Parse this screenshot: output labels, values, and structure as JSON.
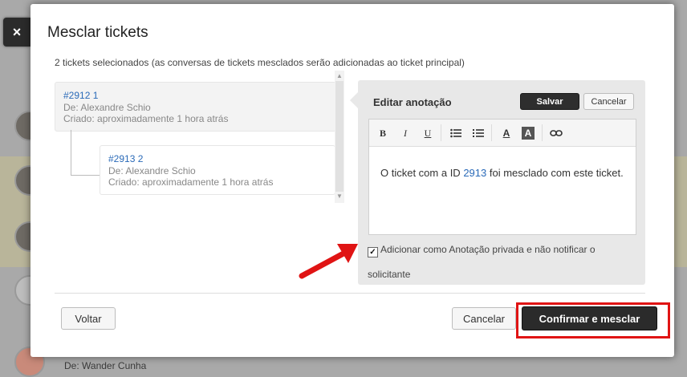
{
  "dialog": {
    "close_glyph": "×",
    "title": "Mesclar tickets",
    "subtitle": "2 tickets selecionados (as conversas de tickets mesclados serão adicionadas ao ticket principal)"
  },
  "tickets": [
    {
      "id_label": "#2912 1",
      "author": "De: Alexandre Schio",
      "created": "Criado: aproximadamente 1 hora atrás"
    },
    {
      "id_label": "#2913 2",
      "author": "De: Alexandre Schio",
      "created": "Criado: aproximadamente 1 hora atrás"
    }
  ],
  "note_panel": {
    "title": "Editar anotação",
    "save_label": "Salvar",
    "cancel_label": "Cancelar",
    "toolbar": {
      "bold": "B",
      "italic": "I",
      "underline": "U",
      "text_color": "A",
      "bg_color": "A"
    },
    "note_text_before": "O ticket com a ID ",
    "note_link": "2913",
    "note_text_after": " foi mesclado com este ticket.",
    "private_checkbox_label": "Adicionar como Anotação privada e não notificar o solicitante",
    "private_checked": true
  },
  "footer": {
    "back_label": "Voltar",
    "cancel_label": "Cancelar",
    "confirm_label": "Confirmar e mesclar"
  },
  "background": {
    "partial_text": "De: Wander Cunha"
  },
  "colors": {
    "highlight": "#e01414",
    "link": "#2a6ab8",
    "dark_button": "#2b2b2b"
  }
}
